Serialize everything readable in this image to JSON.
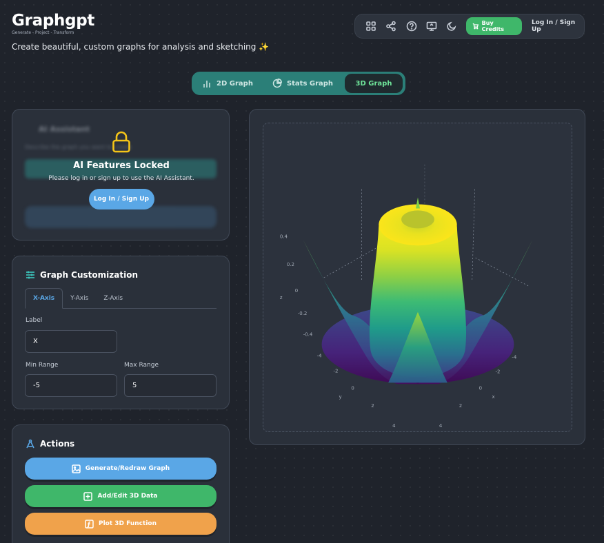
{
  "brand": {
    "title": "Graphgpt",
    "tagline": "Generate - Project - Transform",
    "description": "Create beautiful, custom graphs for analysis and sketching ✨"
  },
  "topbar": {
    "icons": [
      "grid-icon",
      "share-icon",
      "help-icon",
      "present-icon",
      "moon-icon"
    ],
    "buy_credits": "Buy Credits",
    "login": "Log In / Sign Up"
  },
  "graph_tabs": [
    {
      "label": "2D Graph",
      "icon": "bar-chart-icon"
    },
    {
      "label": "Stats Graph",
      "icon": "pie-chart-icon"
    },
    {
      "label": "3D Graph",
      "icon": "",
      "active": true
    }
  ],
  "ai": {
    "title": "AI Assistant",
    "hint": "Describe the graph you want to create",
    "locked_title": "AI Features Locked",
    "locked_desc": "Please log in or sign up to use the AI Assistant.",
    "login_button": "Log In / Sign Up"
  },
  "customization": {
    "title": "Graph Customization",
    "tabs": [
      "X-Axis",
      "Y-Axis",
      "Z-Axis"
    ],
    "active_tab": "X-Axis",
    "label_field": {
      "label": "Label",
      "value": "X"
    },
    "min_range": {
      "label": "Min Range",
      "value": "-5"
    },
    "max_range": {
      "label": "Max Range",
      "value": "5"
    }
  },
  "actions": {
    "title": "Actions",
    "buttons": [
      {
        "label": "Generate/Redraw Graph",
        "icon": "image-icon",
        "color": "#5aa7e6"
      },
      {
        "label": "Add/Edit 3D Data",
        "icon": "plus-square-icon",
        "color": "#3fb76a"
      },
      {
        "label": "Plot 3D Function",
        "icon": "function-icon",
        "color": "#f0a24b"
      }
    ]
  },
  "plot": {
    "z_label": "z",
    "x_label": "x",
    "y_label": "y",
    "z_ticks": [
      "0.4",
      "0.2",
      "0",
      "-0.2",
      "-0.4"
    ],
    "x_ticks": [
      "-4",
      "-2",
      "0",
      "2",
      "4"
    ],
    "y_ticks": [
      "-4",
      "-2",
      "0",
      "2",
      "4"
    ]
  },
  "colors": {
    "accent_blue": "#5aa7e6",
    "accent_green": "#3fb76a",
    "accent_orange": "#f0a24b",
    "tabs_bg": "#2b7f78"
  }
}
